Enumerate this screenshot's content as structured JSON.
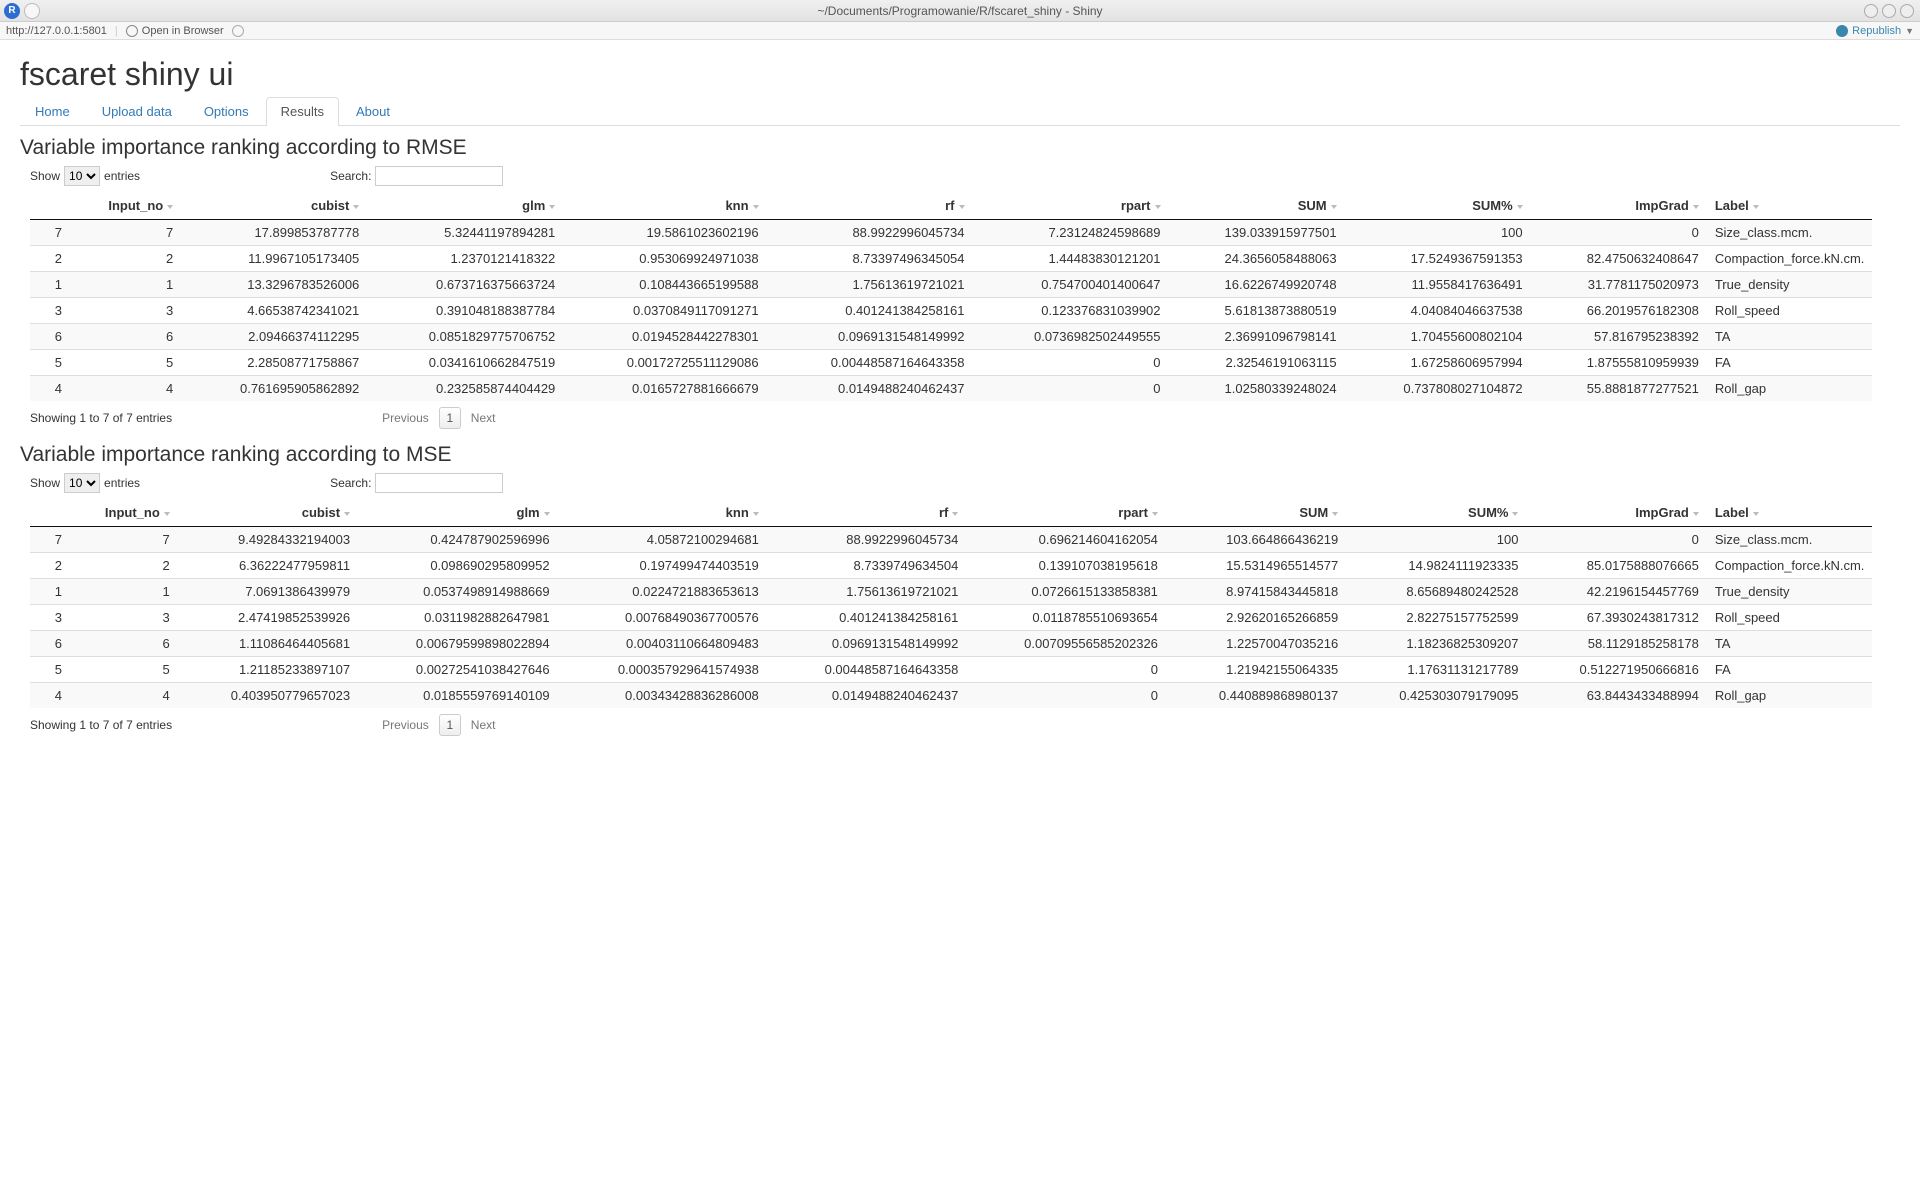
{
  "window": {
    "title": "~/Documents/Programowanie/R/fscaret_shiny - Shiny",
    "r_icon_label": "R"
  },
  "toolbar": {
    "url": "http://127.0.0.1:5801",
    "open_browser": "Open in Browser",
    "republish": "Republish"
  },
  "page": {
    "title": "fscaret shiny ui"
  },
  "tabs": [
    "Home",
    "Upload data",
    "Options",
    "Results",
    "About"
  ],
  "active_tab": 3,
  "sections": {
    "rmse_title": "Variable importance ranking according to RMSE",
    "mse_title": "Variable importance ranking according to MSE"
  },
  "dt_strings": {
    "show": "Show",
    "entries": "entries",
    "search": "Search:",
    "info": "Showing 1 to 7 of 7 entries",
    "previous": "Previous",
    "page1": "1",
    "next": "Next",
    "length_value": "10"
  },
  "columns": [
    "",
    "Input_no",
    "cubist",
    "glm",
    "knn",
    "rf",
    "rpart",
    "SUM",
    "SUM%",
    "ImpGrad",
    "Label"
  ],
  "rmse_rows": [
    [
      "7",
      "7",
      "17.899853787778",
      "5.32441197894281",
      "19.5861023602196",
      "88.9922996045734",
      "7.23124824598689",
      "139.033915977501",
      "100",
      "0",
      "Size_class.mcm."
    ],
    [
      "2",
      "2",
      "11.9967105173405",
      "1.2370121418322",
      "0.953069924971038",
      "8.73397496345054",
      "1.44483830121201",
      "24.3656058488063",
      "17.5249367591353",
      "82.4750632408647",
      "Compaction_force.kN.cm."
    ],
    [
      "1",
      "1",
      "13.3296783526006",
      "0.673716375663724",
      "0.108443665199588",
      "1.75613619721021",
      "0.754700401400647",
      "16.6226749920748",
      "11.9558417636491",
      "31.7781175020973",
      "True_density"
    ],
    [
      "3",
      "3",
      "4.66538742341021",
      "0.391048188387784",
      "0.0370849117091271",
      "0.401241384258161",
      "0.123376831039902",
      "5.61813873880519",
      "4.04084046637538",
      "66.2019576182308",
      "Roll_speed"
    ],
    [
      "6",
      "6",
      "2.09466374112295",
      "0.0851829775706752",
      "0.0194528442278301",
      "0.0969131548149992",
      "0.0736982502449555",
      "2.36991096798141",
      "1.70455600802104",
      "57.816795238392",
      "TA"
    ],
    [
      "5",
      "5",
      "2.28508771758867",
      "0.0341610662847519",
      "0.00172725511129086",
      "0.00448587164643358",
      "0",
      "2.32546191063115",
      "1.67258606957994",
      "1.87555810959939",
      "FA"
    ],
    [
      "4",
      "4",
      "0.761695905862892",
      "0.232585874404429",
      "0.0165727881666679",
      "0.0149488240462437",
      "0",
      "1.02580339248024",
      "0.737808027104872",
      "55.8881877277521",
      "Roll_gap"
    ]
  ],
  "mse_rows": [
    [
      "7",
      "7",
      "9.49284332194003",
      "0.424787902596996",
      "4.05872100294681",
      "88.9922996045734",
      "0.696214604162054",
      "103.664866436219",
      "100",
      "0",
      "Size_class.mcm."
    ],
    [
      "2",
      "2",
      "6.36222477959811",
      "0.098690295809952",
      "0.197499474403519",
      "8.7339749634504",
      "0.139107038195618",
      "15.5314965514577",
      "14.9824111923335",
      "85.0175888076665",
      "Compaction_force.kN.cm."
    ],
    [
      "1",
      "1",
      "7.0691386439979",
      "0.0537498914988669",
      "0.0224721883653613",
      "1.75613619721021",
      "0.0726615133858381",
      "8.97415843445818",
      "8.65689480242528",
      "42.2196154457769",
      "True_density"
    ],
    [
      "3",
      "3",
      "2.47419852539926",
      "0.0311982882647981",
      "0.00768490367700576",
      "0.401241384258161",
      "0.0118785510693654",
      "2.92620165266859",
      "2.82275157752599",
      "67.3930243817312",
      "Roll_speed"
    ],
    [
      "6",
      "6",
      "1.11086464405681",
      "0.00679599898022894",
      "0.00403110664809483",
      "0.0969131548149992",
      "0.00709556585202326",
      "1.22570047035216",
      "1.18236825309207",
      "58.1129185258178",
      "TA"
    ],
    [
      "5",
      "5",
      "1.21185233897107",
      "0.00272541038427646",
      "0.000357929641574938",
      "0.00448587164643358",
      "0",
      "1.21942155064335",
      "1.17631131217789",
      "0.512271950666816",
      "FA"
    ],
    [
      "4",
      "4",
      "0.403950779657023",
      "0.0185559769140109",
      "0.00343428836286008",
      "0.0149488240462437",
      "0",
      "0.440889868980137",
      "0.425303079179095",
      "63.8443433488994",
      "Roll_gap"
    ]
  ]
}
